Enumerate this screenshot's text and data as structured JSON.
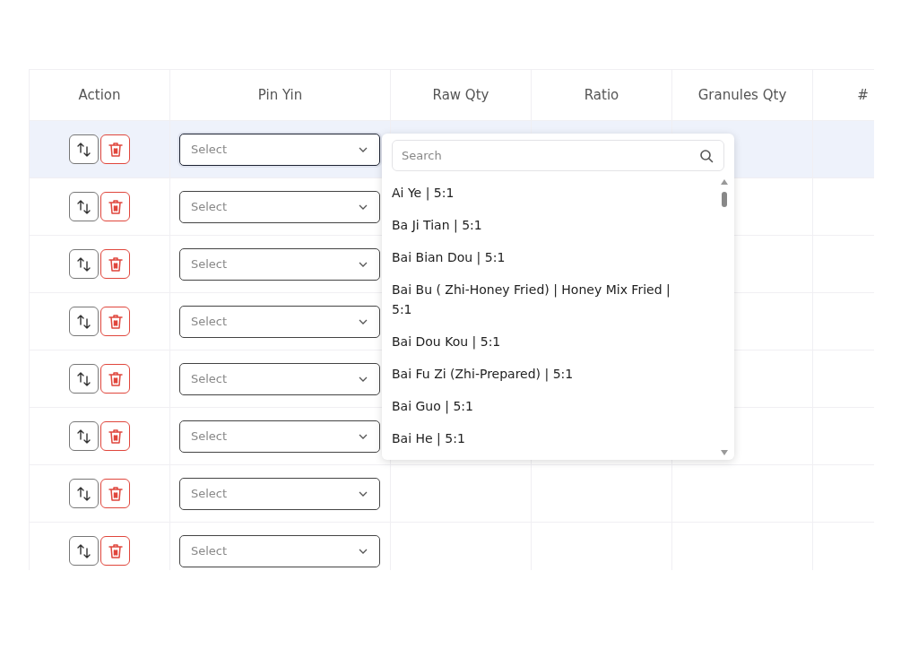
{
  "table": {
    "columns": [
      "Action",
      "Pin Yin",
      "Raw Qty",
      "Ratio",
      "Granules Qty",
      "#"
    ],
    "rows": [
      {
        "selected": true,
        "pin_yin": {
          "placeholder": "Select",
          "open": true
        }
      },
      {
        "selected": false,
        "pin_yin": {
          "placeholder": "Select",
          "open": false
        }
      },
      {
        "selected": false,
        "pin_yin": {
          "placeholder": "Select",
          "open": false
        }
      },
      {
        "selected": false,
        "pin_yin": {
          "placeholder": "Select",
          "open": false
        }
      },
      {
        "selected": false,
        "pin_yin": {
          "placeholder": "Select",
          "open": false
        }
      },
      {
        "selected": false,
        "pin_yin": {
          "placeholder": "Select",
          "open": false
        }
      },
      {
        "selected": false,
        "pin_yin": {
          "placeholder": "Select",
          "open": false
        }
      },
      {
        "selected": false,
        "pin_yin": {
          "placeholder": "Select",
          "open": false
        }
      }
    ]
  },
  "dropdown": {
    "search": {
      "placeholder": "Search"
    },
    "options": [
      "Ai Ye | 5:1",
      "Ba Ji Tian | 5:1",
      "Bai Bian Dou | 5:1",
      "Bai Bu ( Zhi-Honey Fried) | Honey Mix Fried | 5:1",
      "Bai Dou Kou | 5:1",
      "Bai Fu Zi (Zhi-Prepared) | 5:1",
      "Bai Guo | 5:1",
      "Bai He | 5:1"
    ]
  }
}
